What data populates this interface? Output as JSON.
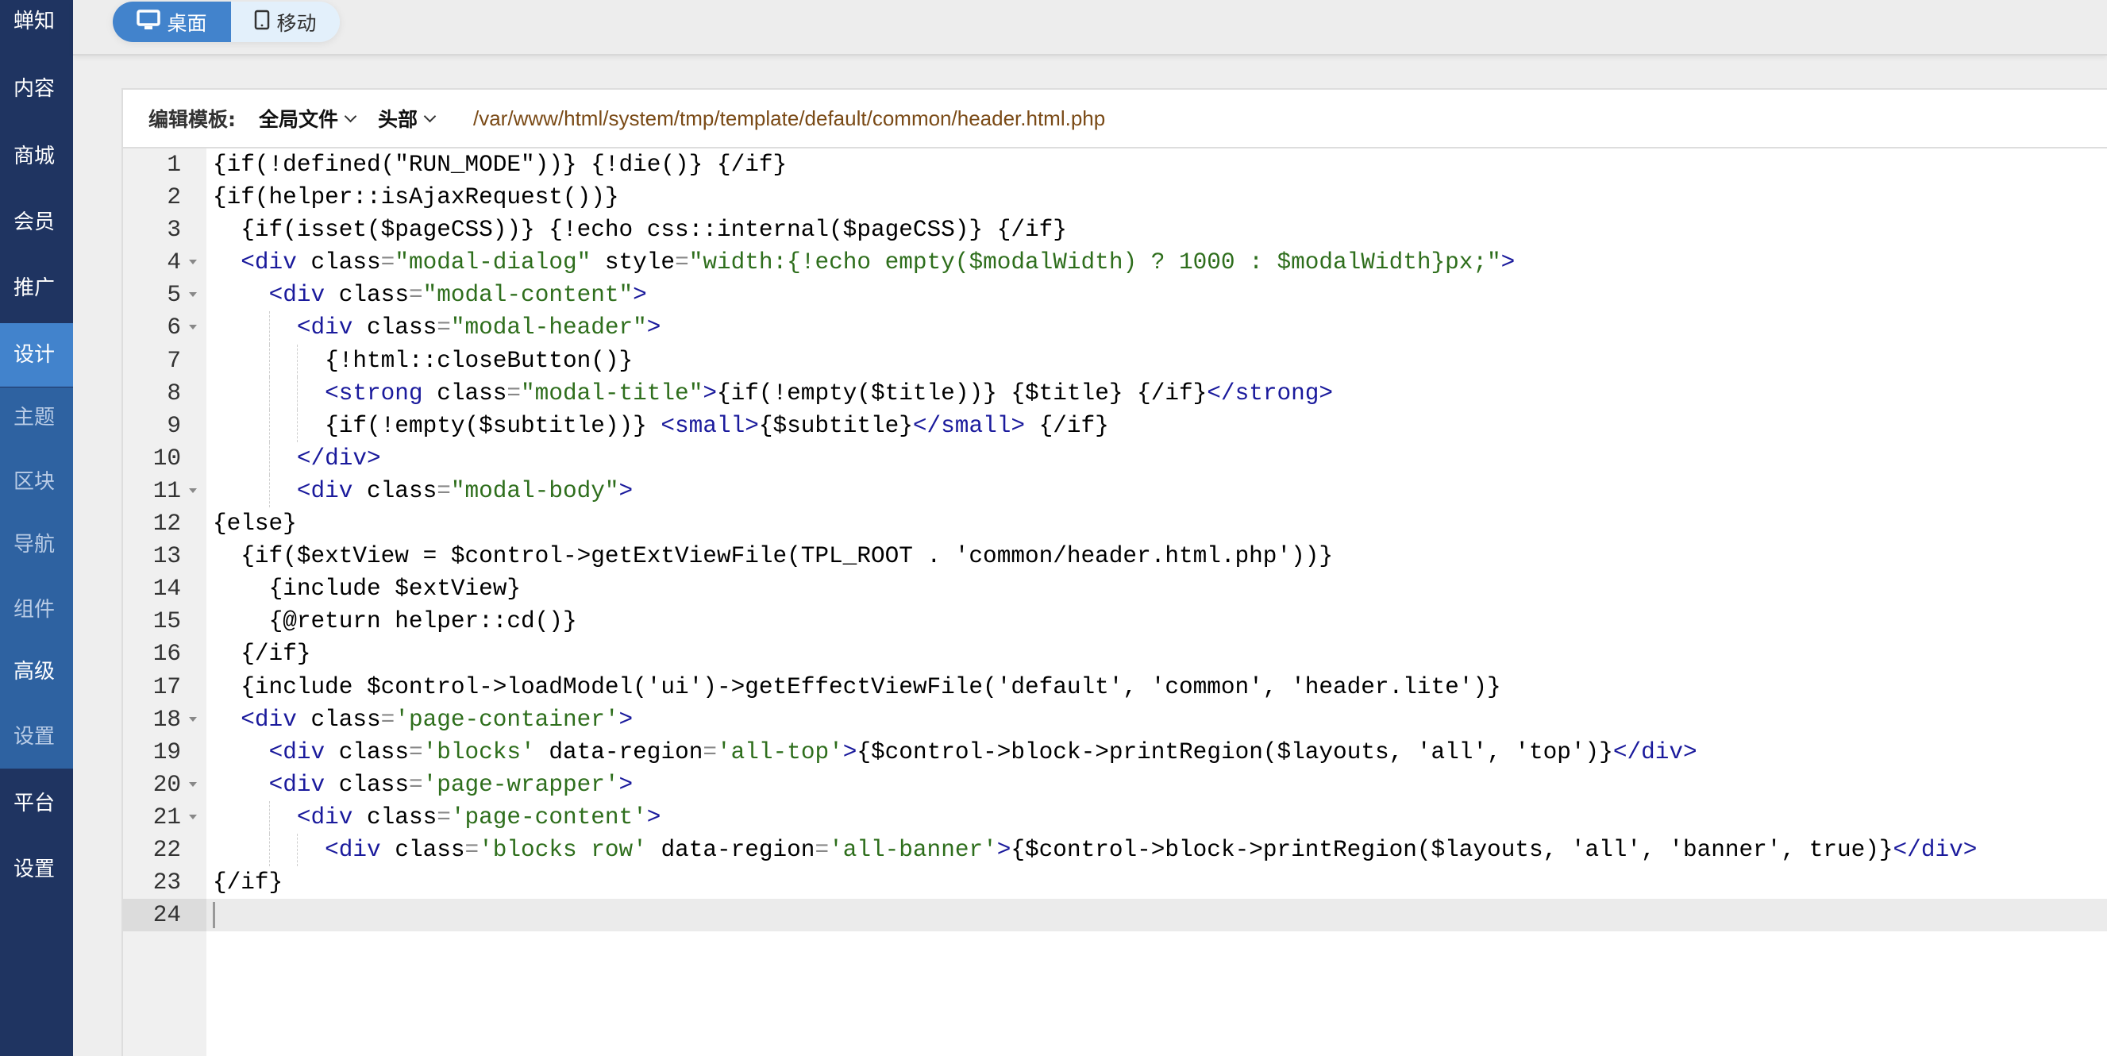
{
  "sidebar": {
    "items": [
      {
        "label": "蝉知",
        "active": false
      },
      {
        "label": "内容",
        "active": false
      },
      {
        "label": "商城",
        "active": false
      },
      {
        "label": "会员",
        "active": false
      },
      {
        "label": "推广",
        "active": false
      },
      {
        "label": "设计",
        "active": true
      }
    ],
    "sub_items": [
      {
        "label": "主题",
        "highlight": false
      },
      {
        "label": "区块",
        "highlight": false
      },
      {
        "label": "导航",
        "highlight": false
      },
      {
        "label": "组件",
        "highlight": false
      },
      {
        "label": "高级",
        "highlight": true
      },
      {
        "label": "设置",
        "highlight": false
      }
    ],
    "bottom_items": [
      {
        "label": "平台"
      },
      {
        "label": "设置"
      }
    ]
  },
  "device_toggle": {
    "desktop": {
      "label": "桌面",
      "icon": "desktop-icon",
      "selected": true
    },
    "mobile": {
      "label": "移动",
      "icon": "tablet-icon",
      "selected": false
    }
  },
  "editor": {
    "label": "编辑模板:",
    "scope_dropdown": "全局文件",
    "part_dropdown": "头部",
    "file_path": "/var/www/html/system/tmp/template/default/common/header.html.php",
    "current_line": 24,
    "lines": [
      {
        "n": 1,
        "fold": false,
        "indent": 0,
        "tokens": [
          [
            "p",
            "{if(!defined(\"RUN_MODE\"))} {!die()} {/if}"
          ]
        ]
      },
      {
        "n": 2,
        "fold": false,
        "indent": 0,
        "tokens": [
          [
            "p",
            "{if(helper::isAjaxRequest())}"
          ]
        ]
      },
      {
        "n": 3,
        "fold": false,
        "indent": 1,
        "tokens": [
          [
            "p",
            "{if(isset($pageCSS))} {!echo css::internal($pageCSS)} {/if}"
          ]
        ]
      },
      {
        "n": 4,
        "fold": true,
        "indent": 1,
        "tokens": [
          [
            "tag",
            "<div"
          ],
          [
            "p",
            " "
          ],
          [
            "attr",
            "class"
          ],
          [
            "eq",
            "="
          ],
          [
            "str",
            "\"modal-dialog\""
          ],
          [
            "p",
            " "
          ],
          [
            "attr",
            "style"
          ],
          [
            "eq",
            "="
          ],
          [
            "str",
            "\"width:{!echo empty($modalWidth) ? 1000 : $modalWidth}px;\""
          ],
          [
            "tag",
            ">"
          ]
        ]
      },
      {
        "n": 5,
        "fold": true,
        "indent": 2,
        "tokens": [
          [
            "tag",
            "<div"
          ],
          [
            "p",
            " "
          ],
          [
            "attr",
            "class"
          ],
          [
            "eq",
            "="
          ],
          [
            "str",
            "\"modal-content\""
          ],
          [
            "tag",
            ">"
          ]
        ]
      },
      {
        "n": 6,
        "fold": true,
        "indent": 3,
        "tokens": [
          [
            "tag",
            "<div"
          ],
          [
            "p",
            " "
          ],
          [
            "attr",
            "class"
          ],
          [
            "eq",
            "="
          ],
          [
            "str",
            "\"modal-header\""
          ],
          [
            "tag",
            ">"
          ]
        ]
      },
      {
        "n": 7,
        "fold": false,
        "indent": 4,
        "tokens": [
          [
            "p",
            "{!html::closeButton()}"
          ]
        ]
      },
      {
        "n": 8,
        "fold": false,
        "indent": 4,
        "tokens": [
          [
            "tag",
            "<strong"
          ],
          [
            "p",
            " "
          ],
          [
            "attr",
            "class"
          ],
          [
            "eq",
            "="
          ],
          [
            "str",
            "\"modal-title\""
          ],
          [
            "tag",
            ">"
          ],
          [
            "p",
            "{if(!empty($title))} {$title} {/if}"
          ],
          [
            "tag",
            "</strong>"
          ]
        ]
      },
      {
        "n": 9,
        "fold": false,
        "indent": 4,
        "tokens": [
          [
            "p",
            "{if(!empty($subtitle))} "
          ],
          [
            "tag",
            "<small>"
          ],
          [
            "p",
            "{$subtitle}"
          ],
          [
            "tag",
            "</small>"
          ],
          [
            "p",
            " {/if}"
          ]
        ]
      },
      {
        "n": 10,
        "fold": false,
        "indent": 3,
        "tokens": [
          [
            "tag",
            "</div>"
          ]
        ]
      },
      {
        "n": 11,
        "fold": true,
        "indent": 3,
        "tokens": [
          [
            "tag",
            "<div"
          ],
          [
            "p",
            " "
          ],
          [
            "attr",
            "class"
          ],
          [
            "eq",
            "="
          ],
          [
            "str",
            "\"modal-body\""
          ],
          [
            "tag",
            ">"
          ]
        ]
      },
      {
        "n": 12,
        "fold": false,
        "indent": 0,
        "tokens": [
          [
            "p",
            "{else}"
          ]
        ]
      },
      {
        "n": 13,
        "fold": false,
        "indent": 1,
        "tokens": [
          [
            "p",
            "{if($extView = $control->getExtViewFile(TPL_ROOT . 'common/header.html.php'))}"
          ]
        ]
      },
      {
        "n": 14,
        "fold": false,
        "indent": 2,
        "tokens": [
          [
            "p",
            "{include $extView}"
          ]
        ]
      },
      {
        "n": 15,
        "fold": false,
        "indent": 2,
        "tokens": [
          [
            "p",
            "{@return helper::cd()}"
          ]
        ]
      },
      {
        "n": 16,
        "fold": false,
        "indent": 1,
        "tokens": [
          [
            "p",
            "{/if}"
          ]
        ]
      },
      {
        "n": 17,
        "fold": false,
        "indent": 1,
        "tokens": [
          [
            "p",
            "{include $control->loadModel('ui')->getEffectViewFile('default', 'common', 'header.lite')}"
          ]
        ]
      },
      {
        "n": 18,
        "fold": true,
        "indent": 1,
        "tokens": [
          [
            "tag",
            "<div"
          ],
          [
            "p",
            " "
          ],
          [
            "attr",
            "class"
          ],
          [
            "eq",
            "="
          ],
          [
            "str",
            "'page-container'"
          ],
          [
            "tag",
            ">"
          ]
        ]
      },
      {
        "n": 19,
        "fold": false,
        "indent": 2,
        "tokens": [
          [
            "tag",
            "<div"
          ],
          [
            "p",
            " "
          ],
          [
            "attr",
            "class"
          ],
          [
            "eq",
            "="
          ],
          [
            "str",
            "'blocks'"
          ],
          [
            "p",
            " "
          ],
          [
            "attr",
            "data-region"
          ],
          [
            "eq",
            "="
          ],
          [
            "str",
            "'all-top'"
          ],
          [
            "tag",
            ">"
          ],
          [
            "p",
            "{$control->block->printRegion($layouts, 'all', 'top')}"
          ],
          [
            "tag",
            "</div>"
          ]
        ]
      },
      {
        "n": 20,
        "fold": true,
        "indent": 2,
        "tokens": [
          [
            "tag",
            "<div"
          ],
          [
            "p",
            " "
          ],
          [
            "attr",
            "class"
          ],
          [
            "eq",
            "="
          ],
          [
            "str",
            "'page-wrapper'"
          ],
          [
            "tag",
            ">"
          ]
        ]
      },
      {
        "n": 21,
        "fold": true,
        "indent": 3,
        "tokens": [
          [
            "tag",
            "<div"
          ],
          [
            "p",
            " "
          ],
          [
            "attr",
            "class"
          ],
          [
            "eq",
            "="
          ],
          [
            "str",
            "'page-content'"
          ],
          [
            "tag",
            ">"
          ]
        ]
      },
      {
        "n": 22,
        "fold": false,
        "indent": 4,
        "tokens": [
          [
            "tag",
            "<div"
          ],
          [
            "p",
            " "
          ],
          [
            "attr",
            "class"
          ],
          [
            "eq",
            "="
          ],
          [
            "str",
            "'blocks row'"
          ],
          [
            "p",
            " "
          ],
          [
            "attr",
            "data-region"
          ],
          [
            "eq",
            "="
          ],
          [
            "str",
            "'all-banner'"
          ],
          [
            "tag",
            ">"
          ],
          [
            "p",
            "{$control->block->printRegion($layouts, 'all', 'banner', true)}"
          ],
          [
            "tag",
            "</div>"
          ]
        ]
      },
      {
        "n": 23,
        "fold": false,
        "indent": 0,
        "tokens": [
          [
            "p",
            "{/if}"
          ]
        ]
      },
      {
        "n": 24,
        "fold": false,
        "indent": 0,
        "tokens": []
      }
    ]
  }
}
